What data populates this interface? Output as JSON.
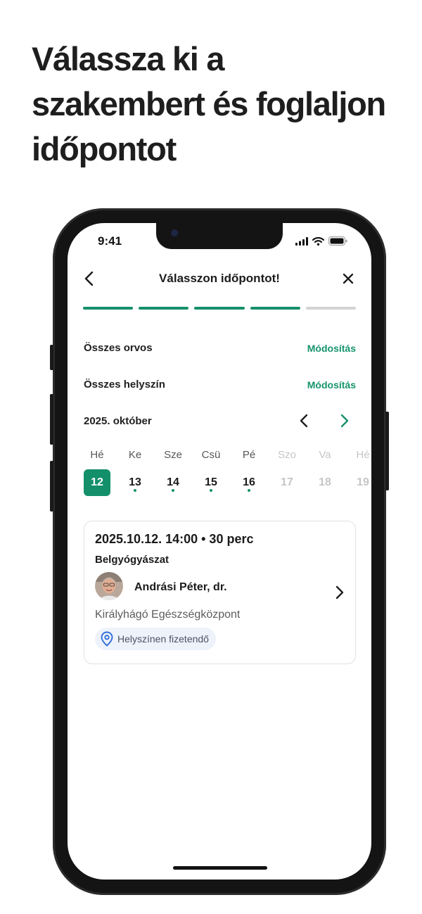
{
  "headline": [
    "Válassza ki a",
    "szakembert és foglaljon",
    "időpontot"
  ],
  "status_bar": {
    "time": "9:41"
  },
  "nav": {
    "title": "Válasszon időpontot!",
    "back_icon": "chevron-left-icon",
    "close_icon": "close-icon"
  },
  "progress": {
    "total_steps": 5,
    "completed_steps": 4
  },
  "filters": [
    {
      "label": "Összes orvos",
      "action": "Módosítás"
    },
    {
      "label": "Összes helyszín",
      "action": "Módosítás"
    }
  ],
  "calendar": {
    "month": "2025. október",
    "days": [
      {
        "name": "Hé",
        "num": "12",
        "state": "selected",
        "available": false
      },
      {
        "name": "Ke",
        "num": "13",
        "state": "normal",
        "available": true
      },
      {
        "name": "Sze",
        "num": "14",
        "state": "normal",
        "available": true
      },
      {
        "name": "Csü",
        "num": "15",
        "state": "normal",
        "available": true
      },
      {
        "name": "Pé",
        "num": "16",
        "state": "normal",
        "available": true
      },
      {
        "name": "Szo",
        "num": "17",
        "state": "faded",
        "available": false
      },
      {
        "name": "Va",
        "num": "18",
        "state": "faded",
        "available": false
      },
      {
        "name": "Hé",
        "num": "19",
        "state": "faded",
        "available": false
      }
    ]
  },
  "appointment": {
    "datetime": "2025.10.12. 14:00 • 30 perc",
    "specialty": "Belgyógyászat",
    "doctor": "Andrási Péter, dr.",
    "clinic": "Királyhágó Egészségközpont",
    "payment": "Helyszínen fizetendő",
    "payment_icon": "location-pin-icon"
  },
  "colors": {
    "accent": "#13906a",
    "progress_inactive": "#d3d3d3",
    "badge_bg": "#edf2fb",
    "pin": "#2f6fd6"
  }
}
